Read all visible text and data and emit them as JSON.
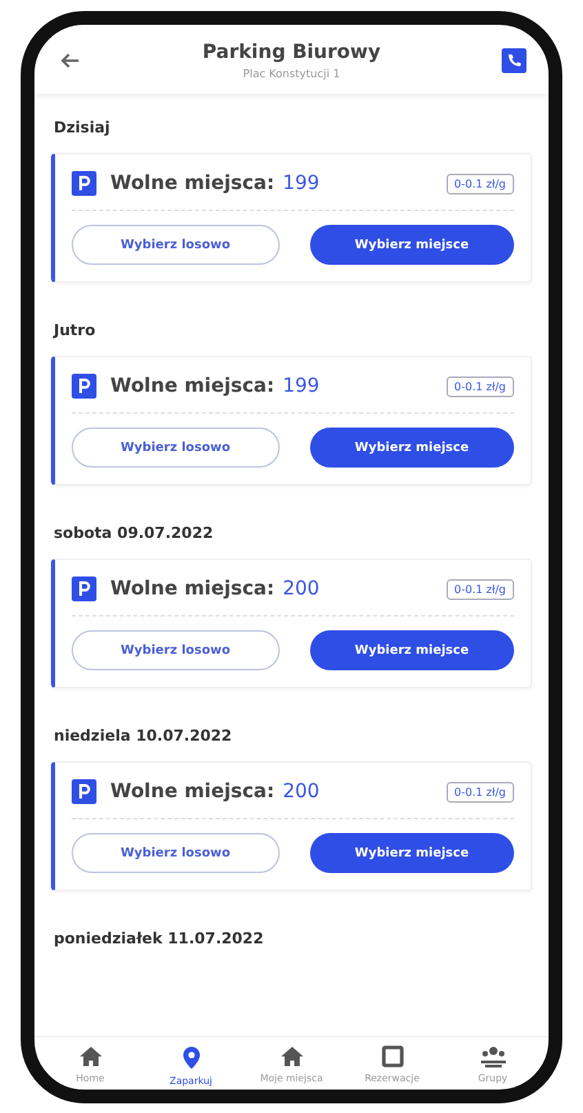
{
  "header": {
    "title": "Parking Biurowy",
    "subtitle": "Plac Konstytucji 1"
  },
  "days": [
    {
      "label": "Dzisiaj",
      "free_label": "Wolne miejsca:",
      "free_count": "199",
      "price": "0-0.1 zł/g",
      "random_button": "Wybierz losowo",
      "choose_button": "Wybierz miejsce"
    },
    {
      "label": "Jutro",
      "free_label": "Wolne miejsca:",
      "free_count": "199",
      "price": "0-0.1 zł/g",
      "random_button": "Wybierz losowo",
      "choose_button": "Wybierz miejsce"
    },
    {
      "label": "sobota 09.07.2022",
      "free_label": "Wolne miejsca:",
      "free_count": "200",
      "price": "0-0.1 zł/g",
      "random_button": "Wybierz losowo",
      "choose_button": "Wybierz miejsce"
    },
    {
      "label": "niedziela 10.07.2022",
      "free_label": "Wolne miejsca:",
      "free_count": "200",
      "price": "0-0.1 zł/g",
      "random_button": "Wybierz losowo",
      "choose_button": "Wybierz miejsce"
    }
  ],
  "next_day_label": "poniedziałek 11.07.2022",
  "bottom_nav": [
    {
      "label": "Home",
      "kind": "house",
      "selected": false
    },
    {
      "label": "Zaparkuj",
      "kind": "pin",
      "selected": true
    },
    {
      "label": "Moje miejsca",
      "kind": "house",
      "selected": false
    },
    {
      "label": "Rezerwacje",
      "kind": "square",
      "selected": false
    },
    {
      "label": "Grupy",
      "kind": "group",
      "selected": false
    }
  ]
}
